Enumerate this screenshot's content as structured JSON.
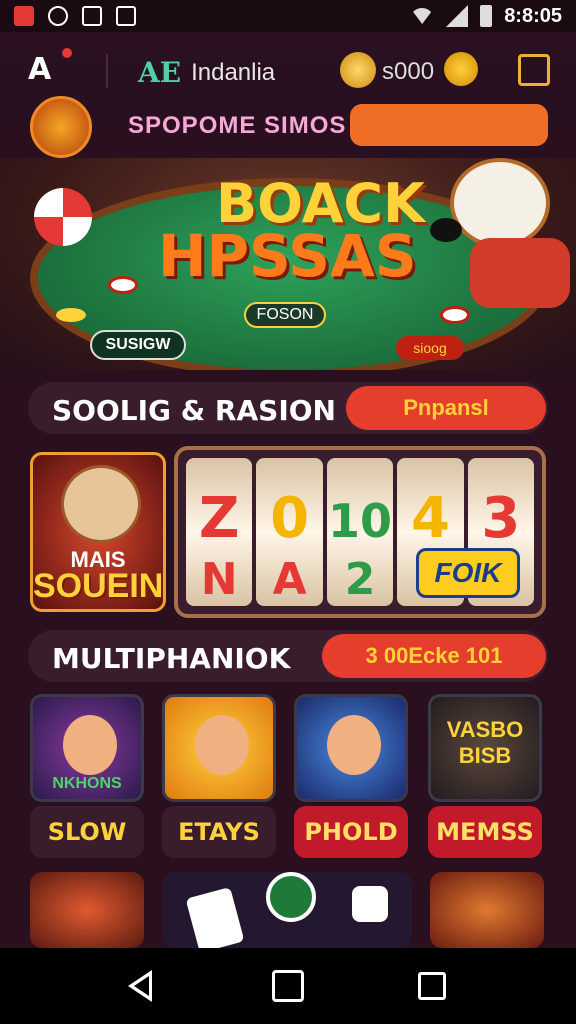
{
  "status_bar": {
    "time": "8:8:05",
    "icons": [
      "alert-icon",
      "sync-icon",
      "shopping-icon",
      "store-icon",
      "wifi-icon",
      "signal-icon",
      "battery-icon"
    ]
  },
  "header": {
    "logo_mark": "A",
    "brand_mark": "AE",
    "brand_name": "Indanlia",
    "balance": "s000"
  },
  "promo": {
    "text": "SPOPOME SIMOS"
  },
  "hero": {
    "title_line1": "BOACK",
    "title_line2": "HPSSAS",
    "pill_center": "FOSON",
    "pill_left": "SUSIGW",
    "tag_right": "sioog"
  },
  "section1": {
    "title": "SOOLIG & RASION",
    "button": "Pnpansl"
  },
  "slot_feature": {
    "card_line1": "MAIS",
    "card_line2": "SOUEIN",
    "reels": [
      {
        "top": "Z",
        "bottom": "N"
      },
      {
        "top": "0",
        "bottom": "A"
      },
      {
        "top": "10",
        "bottom": "2"
      },
      {
        "top": "4",
        "bottom": ""
      },
      {
        "top": "3",
        "bottom": ""
      }
    ],
    "badge": "FOIK"
  },
  "section2": {
    "title": "MULTIPHANIOK",
    "button": "3 00Ecke 101"
  },
  "games": [
    {
      "caption": "NKHONS",
      "label": "SLOW",
      "style": "dark"
    },
    {
      "caption": "",
      "label": "ETAYS",
      "style": "dark"
    },
    {
      "caption": "",
      "label": "PHOLD",
      "style": "red"
    },
    {
      "caption": "VASBO BISB",
      "label": "MEMSS",
      "style": "red"
    }
  ],
  "colors": {
    "accent": "#f06d25",
    "gold": "#ffd23a",
    "red": "#e53e2c",
    "bg": "#2a0f1e"
  }
}
